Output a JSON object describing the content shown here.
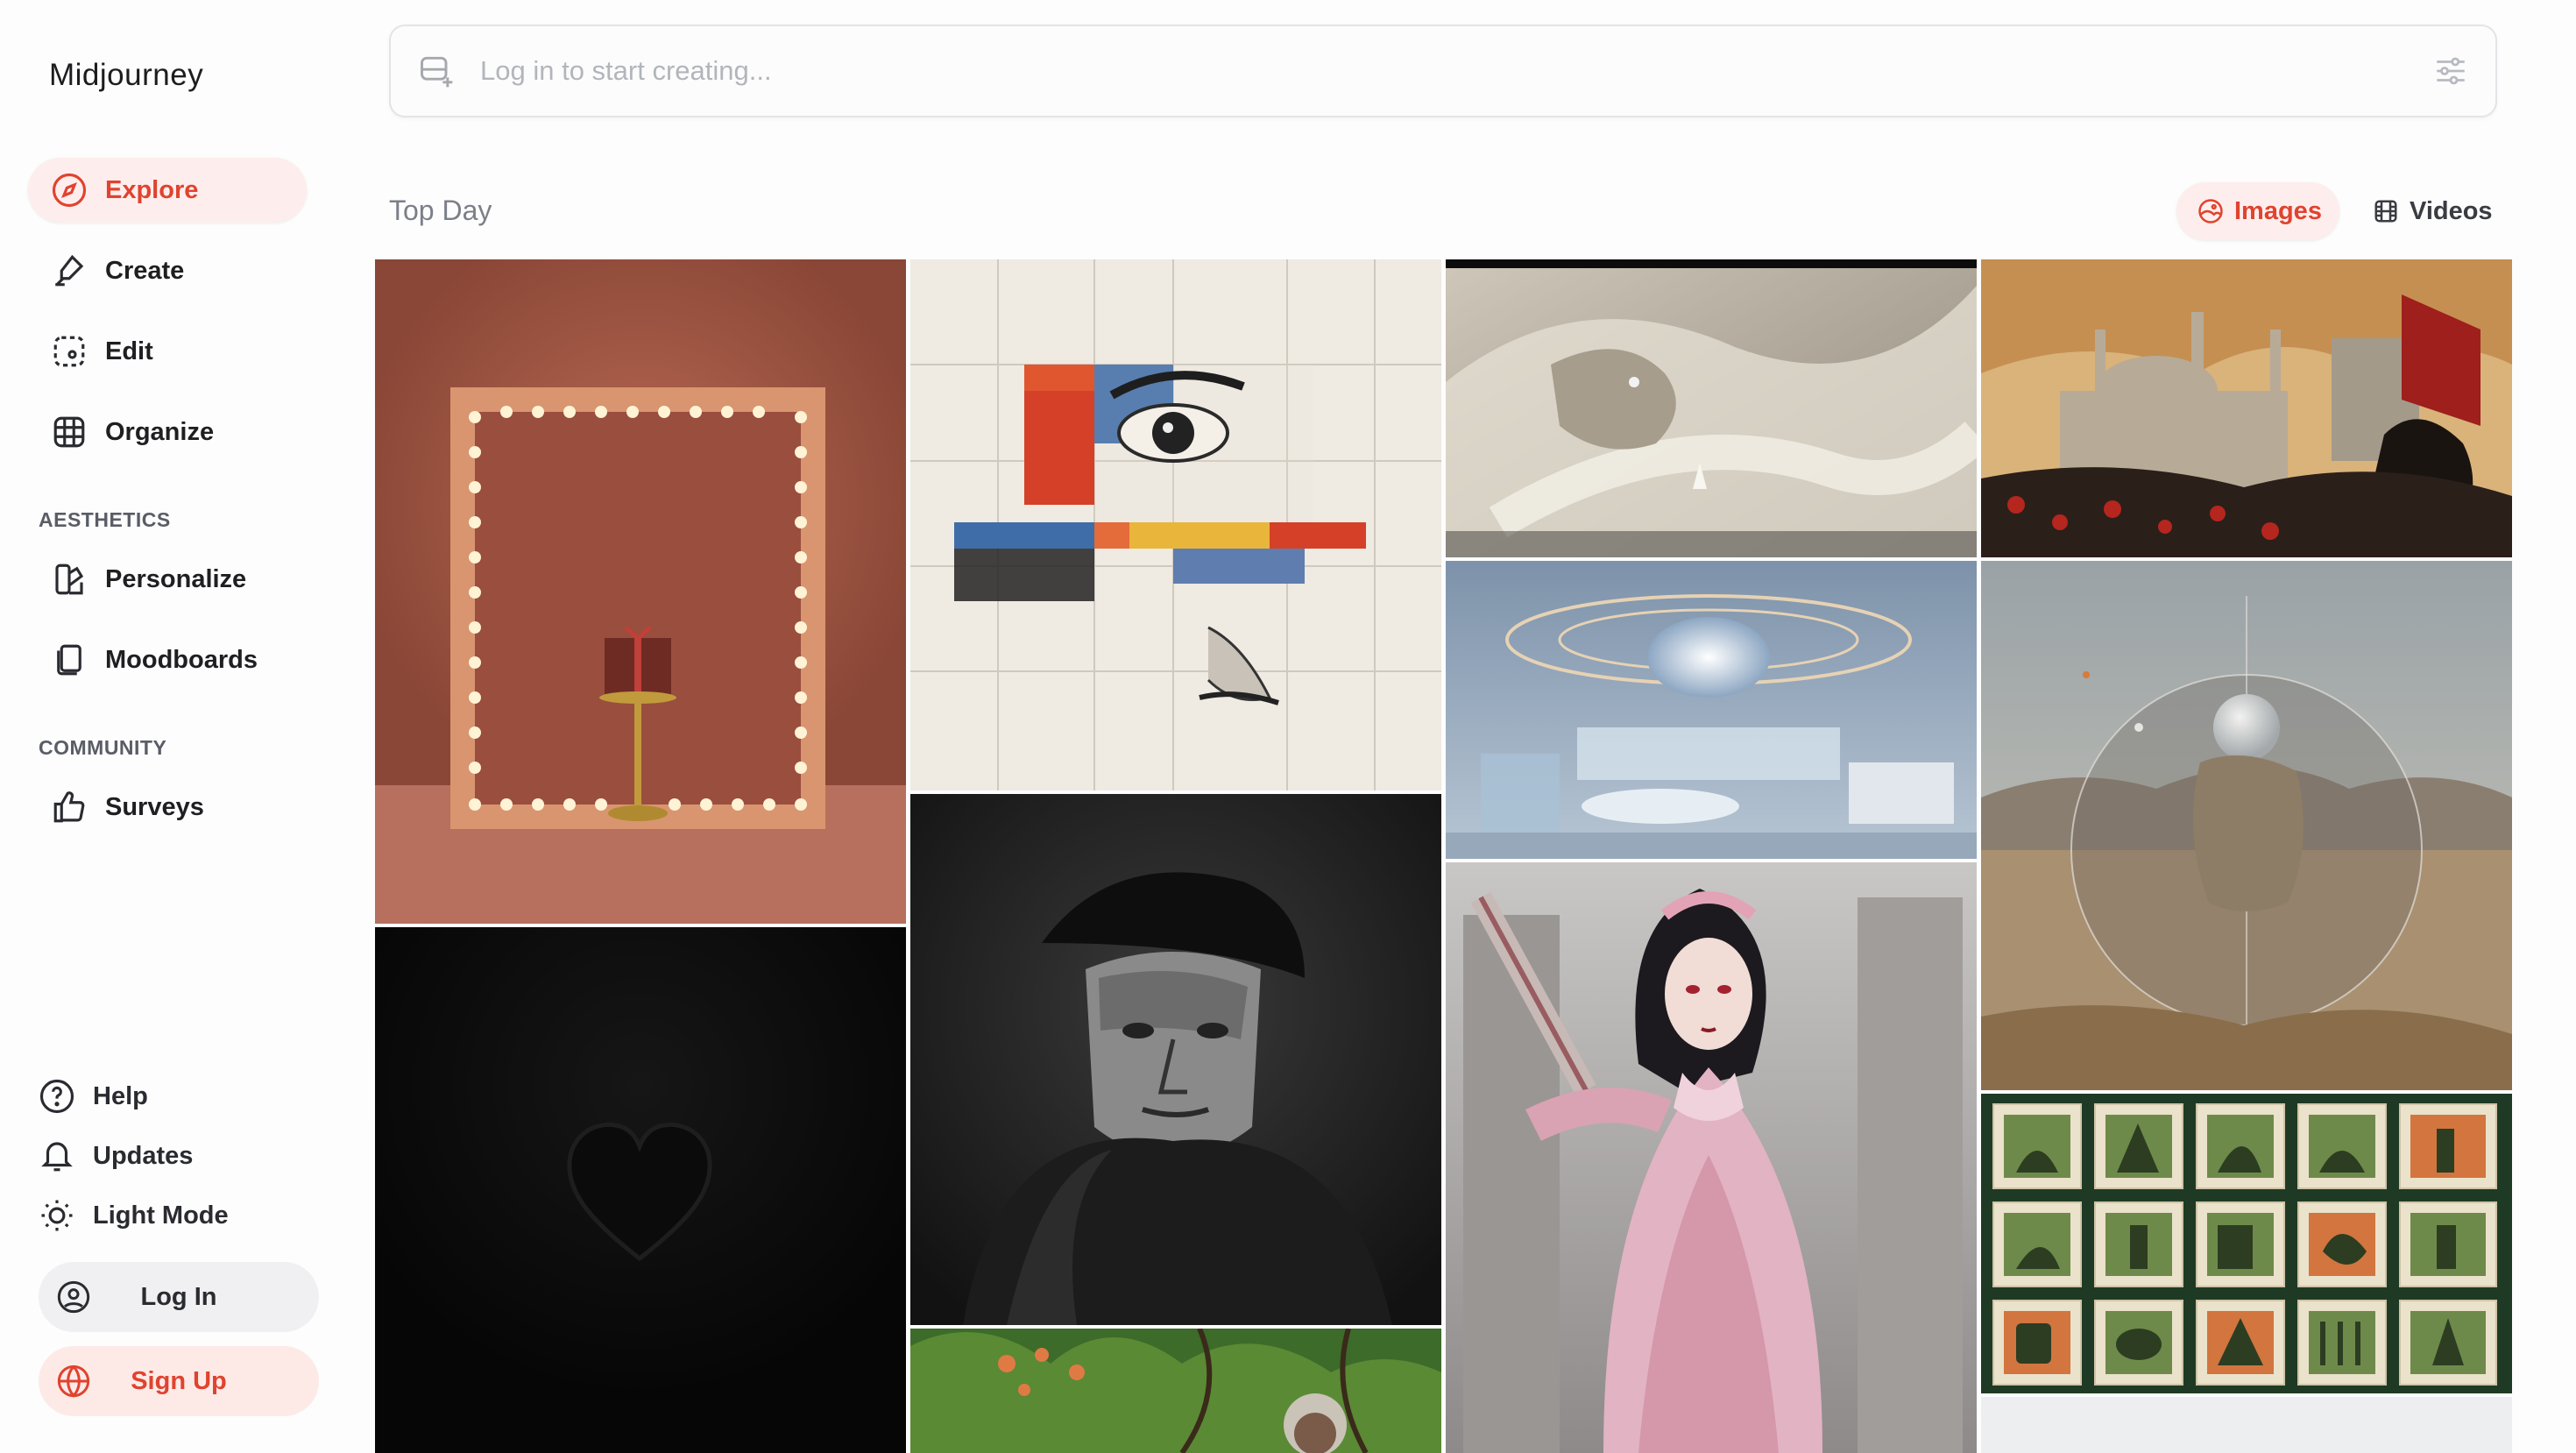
{
  "app": {
    "brand": "Midjourney"
  },
  "nav": {
    "explore": "Explore",
    "create": "Create",
    "edit": "Edit",
    "organize": "Organize",
    "aesthetics_label": "AESTHETICS",
    "personalize": "Personalize",
    "moodboards": "Moodboards",
    "community_label": "COMMUNITY",
    "surveys": "Surveys"
  },
  "footer": {
    "help": "Help",
    "updates": "Updates",
    "light_mode": "Light Mode",
    "log_in": "Log In",
    "sign_up": "Sign Up"
  },
  "search": {
    "placeholder": "Log in to start creating..."
  },
  "feed": {
    "heading": "Top Day",
    "images_label": "Images",
    "videos_label": "Videos"
  },
  "icons": {
    "explore": "compass-icon",
    "create": "brush-icon",
    "edit": "dashed-square-icon",
    "organize": "grid-icon",
    "personalize": "palette-icon",
    "moodboards": "stacked-cards-icon",
    "surveys": "thumbs-up-icon",
    "help": "question-circle-icon",
    "updates": "bell-icon",
    "light_mode": "sun-icon",
    "log_in": "user-circle-icon",
    "sign_up": "globe-icon",
    "search": "image-plus-icon",
    "settings": "sliders-icon"
  },
  "colors": {
    "accent": "#e0432f",
    "accent_bg": "#fdeeed",
    "text": "#1f1f22",
    "muted": "#7c7f88"
  }
}
